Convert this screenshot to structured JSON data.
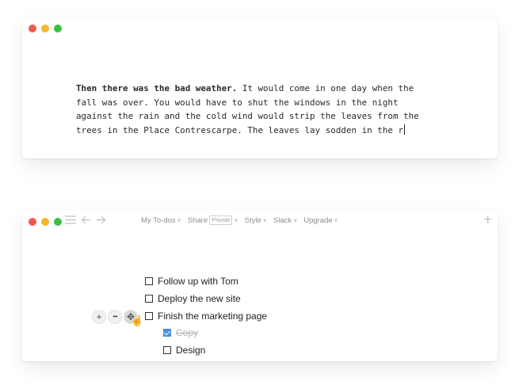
{
  "top_window": {
    "prose_lead": "Then there was the bad weather.",
    "prose_lines": [
      " It would come in one day when the",
      "fall was over. You would have to shut the windows in the night",
      "against the rain and the cold wind would strip the leaves from the",
      "trees in the Place Contrescarpe. The leaves lay sodden in the r"
    ]
  },
  "bottom_window": {
    "nav_icons": [
      "hamburger-icon",
      "arrow-left-icon",
      "arrow-right-icon"
    ],
    "menu": {
      "my_todos": "My To-dos",
      "share": "Share",
      "share_badge": "Private",
      "style": "Style",
      "slack": "Slack",
      "upgrade": "Upgrade"
    },
    "caret_glyph": "∨",
    "new_icon_glyph": "+",
    "row_controls": {
      "add": "+",
      "more": "•••",
      "move": "✥"
    },
    "todos": [
      {
        "label": "Follow up with Tom",
        "checked": false,
        "level": 0
      },
      {
        "label": "Deploy the new site",
        "checked": false,
        "level": 0
      },
      {
        "label": "Finish the marketing page",
        "checked": false,
        "level": 0
      },
      {
        "label": "Copy",
        "checked": true,
        "level": 1
      },
      {
        "label": "Design",
        "checked": false,
        "level": 1
      }
    ]
  }
}
